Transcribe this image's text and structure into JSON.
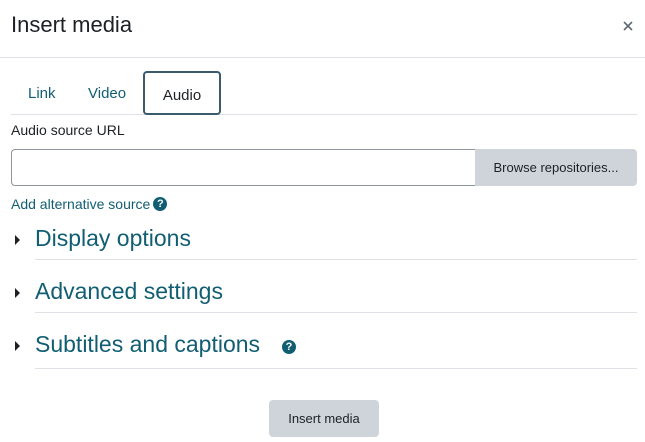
{
  "dialog": {
    "title": "Insert media",
    "close_icon": "close-icon"
  },
  "tabs": [
    {
      "label": "Link",
      "active": false
    },
    {
      "label": "Video",
      "active": false
    },
    {
      "label": "Audio",
      "active": true
    }
  ],
  "audio": {
    "source_label": "Audio source URL",
    "source_value": "",
    "browse_label": "Browse repositories...",
    "add_alt_source": "Add alternative source",
    "help_icon": "help-icon"
  },
  "sections": [
    {
      "label": "Display options",
      "expanded": false
    },
    {
      "label": "Advanced settings",
      "expanded": false
    },
    {
      "label": "Subtitles and captions",
      "expanded": false,
      "has_help": true
    }
  ],
  "footer": {
    "insert_label": "Insert media"
  },
  "colors": {
    "accent": "#115e73",
    "button_bg": "#ced4da",
    "active_tab_border": "#3c5a6e"
  }
}
